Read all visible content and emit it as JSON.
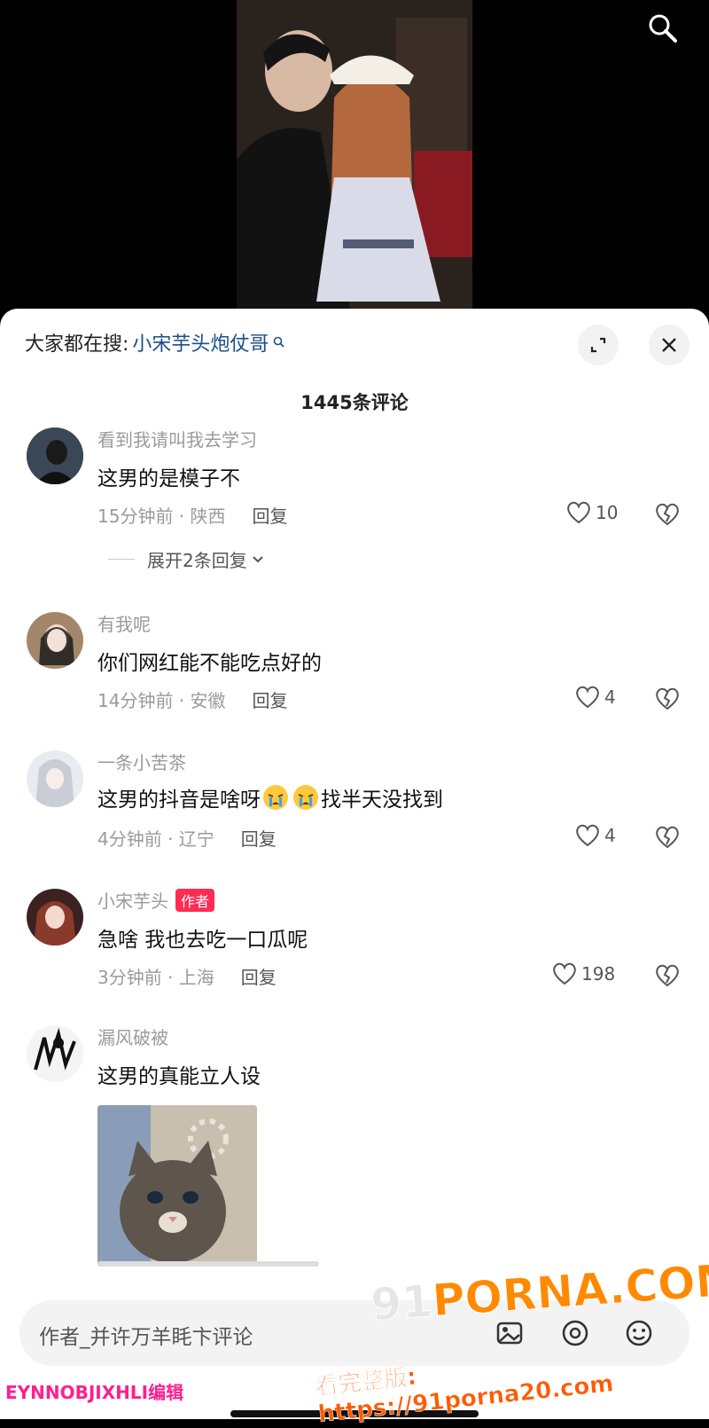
{
  "video": {
    "search_icon": "search-icon"
  },
  "sheet": {
    "suggest_prefix": "大家都在搜:",
    "suggest_keyword": "小宋芋头炮仗哥",
    "comment_count": "1445条评论"
  },
  "comments": [
    {
      "user": "看到我请叫我去学习",
      "text": "这男的是模子不",
      "time_loc": "15分钟前 · 陕西",
      "reply": "回复",
      "likes": "10",
      "expand": "展开2条回复"
    },
    {
      "user": "有我呢",
      "text": "你们网红能不能吃点好的",
      "time_loc": "14分钟前 · 安徽",
      "reply": "回复",
      "likes": "4"
    },
    {
      "user": "一条小苦茶",
      "text_before": "这男的抖音是啥呀",
      "text_after": "找半天没找到",
      "time_loc": "4分钟前 · 辽宁",
      "reply": "回复",
      "likes": "4"
    },
    {
      "user": "小宋芋头",
      "badge": "作者",
      "text": "急啥 我也去吃一口瓜呢",
      "time_loc": "3分钟前 · 上海",
      "reply": "回复",
      "likes": "198"
    },
    {
      "user": "漏风破被",
      "text": "这男的真能立人设"
    }
  ],
  "input": {
    "placeholder": "作者_并许万羊眊卞评论"
  },
  "watermark": {
    "logo_nine": "91",
    "logo": "PORNA.COM",
    "url": "看完整版: https://91porna20.com",
    "left_text": "EYNNOBJIXHLI编辑"
  },
  "colors": {
    "accent": "#fe2c55",
    "link": "#1a4f8a",
    "muted": "#9a9a9a"
  }
}
